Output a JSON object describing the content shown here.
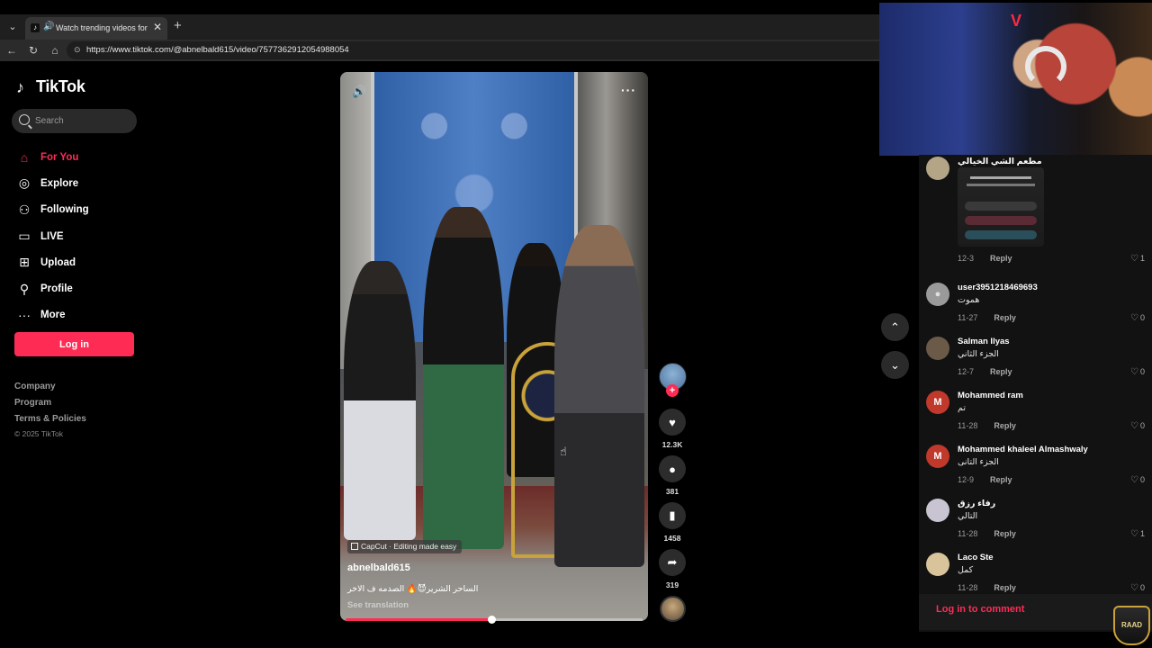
{
  "browser": {
    "tab_title": "Watch trending videos for yo",
    "tab_favicon": "♪",
    "url": "https://www.tiktok.com/@abnelbald615/video/7577362912054988054"
  },
  "sidebar": {
    "logo_text": "TikTok",
    "search_placeholder": "Search",
    "items": [
      {
        "label": "For You",
        "icon": "home-icon",
        "active": true
      },
      {
        "label": "Explore",
        "icon": "compass-icon"
      },
      {
        "label": "Following",
        "icon": "person-plus-icon"
      },
      {
        "label": "LIVE",
        "icon": "live-tv-icon"
      },
      {
        "label": "Upload",
        "icon": "upload-plus-icon"
      },
      {
        "label": "Profile",
        "icon": "person-icon"
      },
      {
        "label": "More",
        "icon": "ellipsis-icon"
      }
    ],
    "login_label": "Log in",
    "footer_links": [
      "Company",
      "Program",
      "Terms & Policies"
    ],
    "copyright": "© 2025 TikTok"
  },
  "video": {
    "capcut_label": "CapCut · Editing made easy",
    "author": "abnelbald615",
    "caption": "الساحر الشرير😈🔥 الصدمه ف الاخر",
    "see_translation": "See translation",
    "progress": 0.49,
    "likes": "12.3K",
    "comments": "381",
    "saves": "1458",
    "shares": "319"
  },
  "comments": [
    {
      "user": "مطعم الشي الخيالي",
      "text": "",
      "date": "12-3",
      "likes": "1",
      "has_image": true,
      "avatar": "photo",
      "color": "#b4a586"
    },
    {
      "user": "user3951218469693",
      "text": "هموت",
      "date": "11-27",
      "likes": "0",
      "avatar": "default",
      "color": "#9a9a9a"
    },
    {
      "user": "Salman Ilyas",
      "text": "الجزء الثاني",
      "date": "12-7",
      "likes": "0",
      "avatar": "photo",
      "color": "#6b5a48"
    },
    {
      "user": "Mohammed ram",
      "text": "تم",
      "date": "11-28",
      "likes": "0",
      "avatar": "M",
      "color": "#c0392b"
    },
    {
      "user": "Mohammed khaleel Almashwaly",
      "text": "الجزء التانى",
      "date": "12-9",
      "likes": "0",
      "avatar": "M",
      "color": "#c0392b"
    },
    {
      "user": "رفاء رزق",
      "text": "التالي",
      "date": "11-28",
      "likes": "1",
      "avatar": "photo",
      "color": "#c9c4d1"
    },
    {
      "user": "Laco Ste",
      "text": "كمل",
      "date": "11-28",
      "likes": "0",
      "avatar": "photo",
      "color": "#d8c39a"
    }
  ],
  "reply_label": "Reply",
  "login_to_comment": "Log in to comment",
  "overlay_badge": "RAAD",
  "colors": {
    "accent": "#fe2c55",
    "background": "#000000",
    "panel": "#121212"
  }
}
